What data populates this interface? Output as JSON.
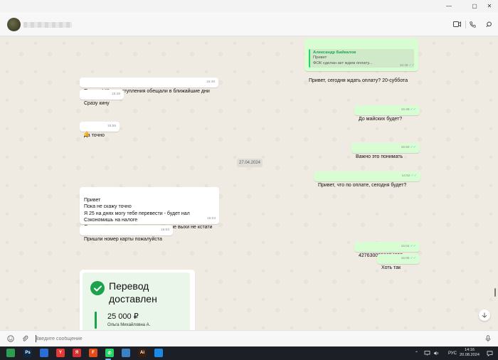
{
  "window": {
    "minimize_icon": "minimize-icon",
    "maximize_icon": "maximize-icon",
    "close_icon": "close-icon"
  },
  "header": {
    "video_icon": "video-call-icon",
    "phone_icon": "phone-call-icon",
    "search_icon": "search-icon"
  },
  "messages": [
    {
      "dir": "out",
      "quote_author": "Александр Байкалов",
      "quote_text": "Привет\nФОК сделан акт ждем оплату...",
      "text": "Привет, сегодня ждать оплату? 20-суббота",
      "time": "15:48"
    },
    {
      "dir": "in",
      "text": "Привет ! Жду поступления обещали в ближайшие дни",
      "time": "15:48"
    },
    {
      "dir": "in",
      "text": "Сразу кину",
      "time": "15:48"
    },
    {
      "dir": "out",
      "text": "До майских будет?",
      "time": "15:48"
    },
    {
      "dir": "in",
      "text": "Да точно",
      "time": "15:55",
      "reaction": "👍"
    },
    {
      "dir": "out",
      "text": "Важно это понимать",
      "time": "15:50"
    },
    {
      "dir": "out",
      "text": "Привет, что по оплате, сегодня будет?",
      "time": "14:52"
    },
    {
      "dir": "in",
      "text": "Привет\nПока не скажу точно\nЯ 25 на днях могу тебе перевести - будет нал\nСэкономишь на налоге\nОстальное пока не знаю - эти затяжные выхи не кстати",
      "time": "15:03"
    },
    {
      "dir": "in",
      "text": "Пришли номер карты пожалуйста",
      "time": "15:03"
    },
    {
      "dir": "out",
      "text": "4276300058654255",
      "time": "15:04"
    },
    {
      "dir": "out",
      "text": "Хоть так",
      "time": "15:05"
    }
  ],
  "date_chip": "27.04.2024",
  "card": {
    "title": "Перевод\nдоставлен",
    "amount": "25 000 ₽",
    "recipient": "Ольга Михайловна А."
  },
  "compose": {
    "placeholder": "Введите сообщение",
    "emoji_icon": "emoji-icon",
    "attach_icon": "attach-icon",
    "mic_icon": "microphone-icon"
  },
  "taskbar": {
    "apps": [
      {
        "name": "file-manager-icon",
        "label": "",
        "color": "#2d9e4f"
      },
      {
        "name": "photoshop-icon",
        "label": "Ps",
        "color": "#0b2a4a"
      },
      {
        "name": "monitor-icon",
        "label": "",
        "color": "#2b6fd6"
      },
      {
        "name": "yandex-icon",
        "label": "Y",
        "color": "#e53935"
      },
      {
        "name": "yandex-browser-icon",
        "label": "Я",
        "color": "#d32f2f"
      },
      {
        "name": "figma-icon",
        "label": "F",
        "color": "#e64a19"
      },
      {
        "name": "whatsapp-icon",
        "label": "✆",
        "color": "#25d366"
      },
      {
        "name": "cloud-app-icon",
        "label": "",
        "color": "#3b82c4"
      },
      {
        "name": "illustrator-icon",
        "label": "Ai",
        "color": "#3a1d0a"
      },
      {
        "name": "paint-icon",
        "label": "",
        "color": "#1e88e5"
      }
    ],
    "lang": "РУС",
    "time": "14:16",
    "date": "20.08.2024"
  }
}
